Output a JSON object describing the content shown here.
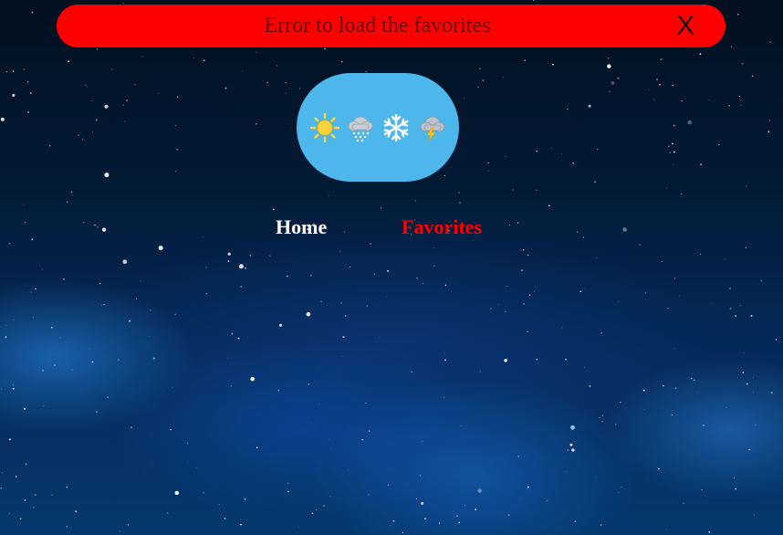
{
  "error_banner": {
    "message": "Error to load the favorites",
    "close_label": "X",
    "background_color": "#ff0000"
  },
  "logo": {
    "background_color": "#4db6ea",
    "icons": [
      "sun-icon",
      "rain-cloud-icon",
      "snowflake-icon",
      "thunder-cloud-icon"
    ]
  },
  "nav": {
    "home_label": "Home",
    "favorites_label": "Favorites",
    "active_color": "#ff0000"
  },
  "background": {
    "description_color": "#052a5a"
  }
}
